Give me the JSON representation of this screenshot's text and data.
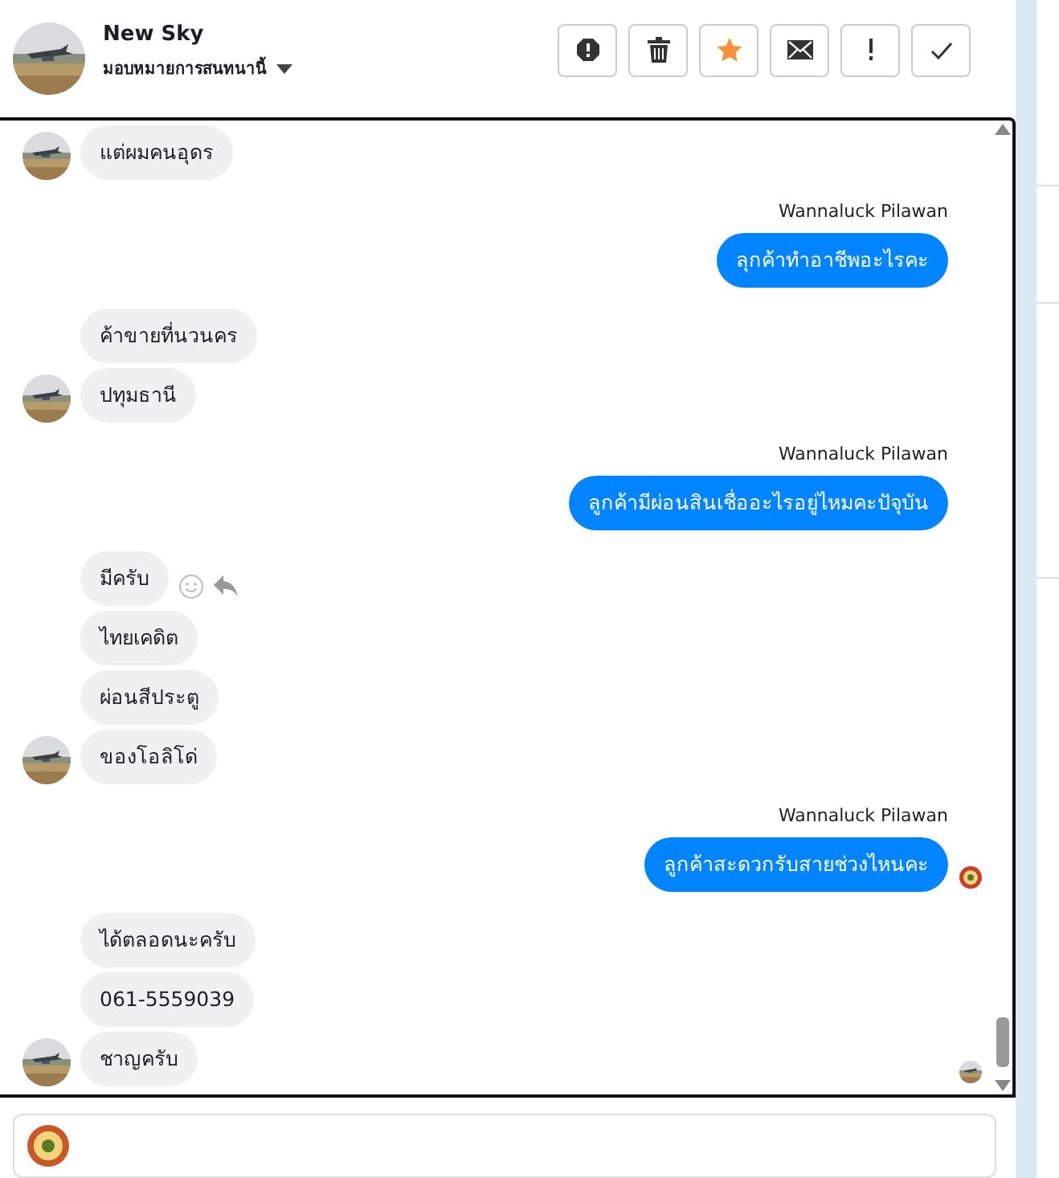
{
  "header": {
    "name": "New Sky",
    "assign_label": "มอบหมายการสนทนานี้",
    "actions": [
      {
        "kind": "report",
        "on": false
      },
      {
        "kind": "delete",
        "on": false
      },
      {
        "kind": "star",
        "on": true
      },
      {
        "kind": "mail",
        "on": false
      },
      {
        "kind": "important",
        "on": false
      },
      {
        "kind": "done",
        "on": false
      }
    ]
  },
  "groups": [
    {
      "kind": "in",
      "read_receipt": false,
      "messages": [
        {
          "text": "แต่ผมคนอุดร",
          "hover_actions": false
        }
      ]
    },
    {
      "kind": "out",
      "sender": "Wannaluck Pilawan",
      "read_receipt": false,
      "messages": [
        {
          "text": "ลุกค้าทำอาชีพอะไรคะ",
          "hover_actions": false
        }
      ]
    },
    {
      "kind": "in",
      "read_receipt": false,
      "messages": [
        {
          "text": "ค้าขายที่นวนคร",
          "hover_actions": false
        },
        {
          "text": "ปทุมธานี",
          "hover_actions": false
        }
      ]
    },
    {
      "kind": "out",
      "sender": "Wannaluck Pilawan",
      "read_receipt": false,
      "messages": [
        {
          "text": "ลูกค้ามีผ่อนสินเชื่ออะไรอยู่ไหมคะปัจุบัน",
          "hover_actions": false
        }
      ]
    },
    {
      "kind": "in",
      "read_receipt": false,
      "messages": [
        {
          "text": "มีครับ",
          "hover_actions": true
        },
        {
          "text": "ไทยเคดิต",
          "hover_actions": false
        },
        {
          "text": "ผ่อนสีประตู",
          "hover_actions": false
        },
        {
          "text": "ของโอลิโด่",
          "hover_actions": false
        }
      ]
    },
    {
      "kind": "out",
      "sender": "Wannaluck Pilawan",
      "read_receipt": true,
      "messages": [
        {
          "text": "ลูกค้าสะดวกรับสายช่วงไหนคะ",
          "hover_actions": false
        }
      ]
    },
    {
      "kind": "in",
      "read_receipt": true,
      "messages": [
        {
          "text": "ได้ตลอดนะครับ",
          "hover_actions": false
        },
        {
          "text": "061-5559039",
          "hover_actions": false
        },
        {
          "text": "ชาญครับ",
          "hover_actions": false
        }
      ]
    }
  ]
}
